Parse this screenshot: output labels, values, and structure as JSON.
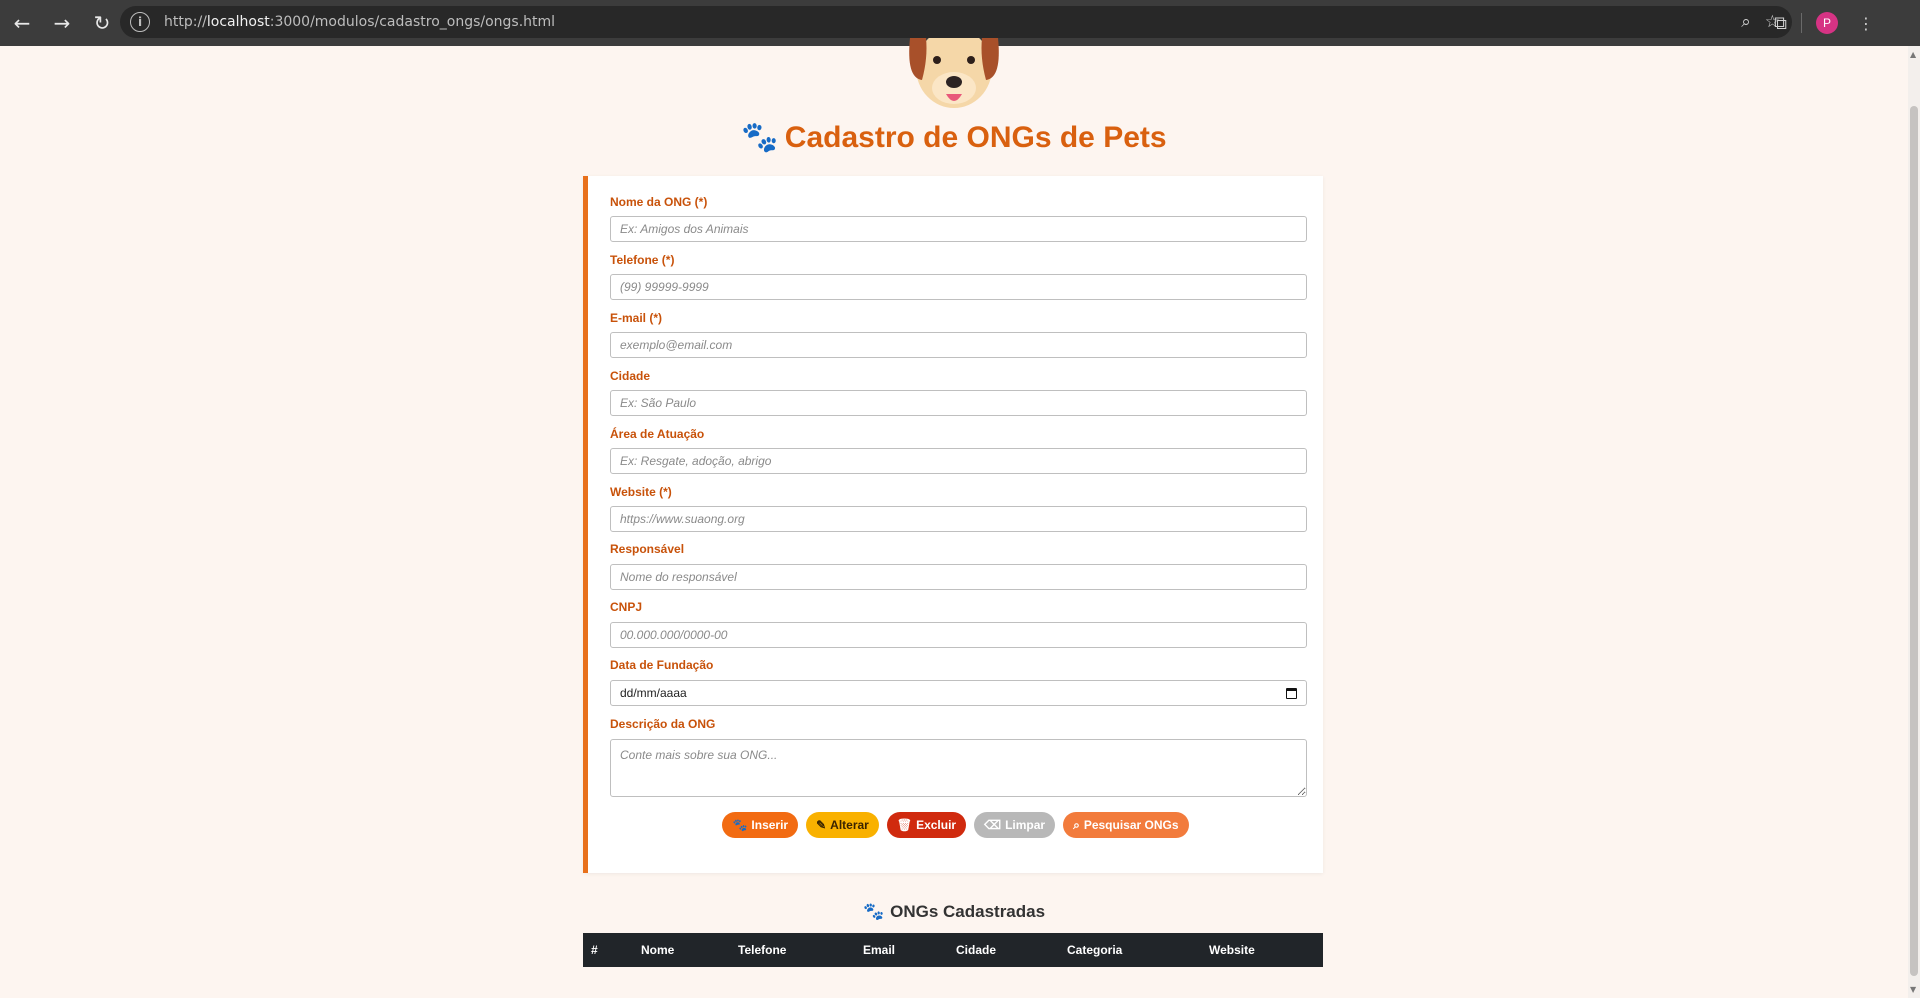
{
  "browser": {
    "url_prefix": "http://",
    "url_host": "localhost",
    "url_rest": ":3000/modulos/cadastro_ongs/ongs.html",
    "profile_initial": "P"
  },
  "page": {
    "title": "Cadastro de ONGs de Pets"
  },
  "form": {
    "fields": [
      {
        "label": "Nome da ONG (*)",
        "placeholder": "Ex: Amigos dos Animais"
      },
      {
        "label": "Telefone (*)",
        "placeholder": "(99) 99999-9999"
      },
      {
        "label": "E-mail (*)",
        "placeholder": "exemplo@email.com"
      },
      {
        "label": "Cidade",
        "placeholder": "Ex: São Paulo"
      },
      {
        "label": "Área de Atuação",
        "placeholder": "Ex: Resgate, adoção, abrigo"
      },
      {
        "label": "Website (*)",
        "placeholder": "https://www.suaong.org"
      },
      {
        "label": "Responsável",
        "placeholder": "Nome do responsável"
      },
      {
        "label": "CNPJ",
        "placeholder": "00.000.000/0000-00"
      },
      {
        "label": "Data de Fundação",
        "value": "dd/mm/aaaa"
      },
      {
        "label": "Descrição da ONG",
        "placeholder": "Conte mais sobre sua ONG..."
      }
    ],
    "buttons": {
      "insert": "Inserir",
      "update": "Alterar",
      "delete": "Excluir",
      "clear": "Limpar",
      "search": "Pesquisar ONGs"
    }
  },
  "list": {
    "title": "ONGs Cadastradas",
    "columns": [
      "#",
      "Nome",
      "Telefone",
      "Email",
      "Cidade",
      "Categoria",
      "Website"
    ]
  },
  "colors": {
    "accent": "#e8701a",
    "title": "#d9600f",
    "insert": "#f26b12",
    "update": "#f9b100",
    "delete": "#d02a0e",
    "clear": "#b8b8b8",
    "search": "#f27b3c",
    "table_header": "#212529"
  }
}
